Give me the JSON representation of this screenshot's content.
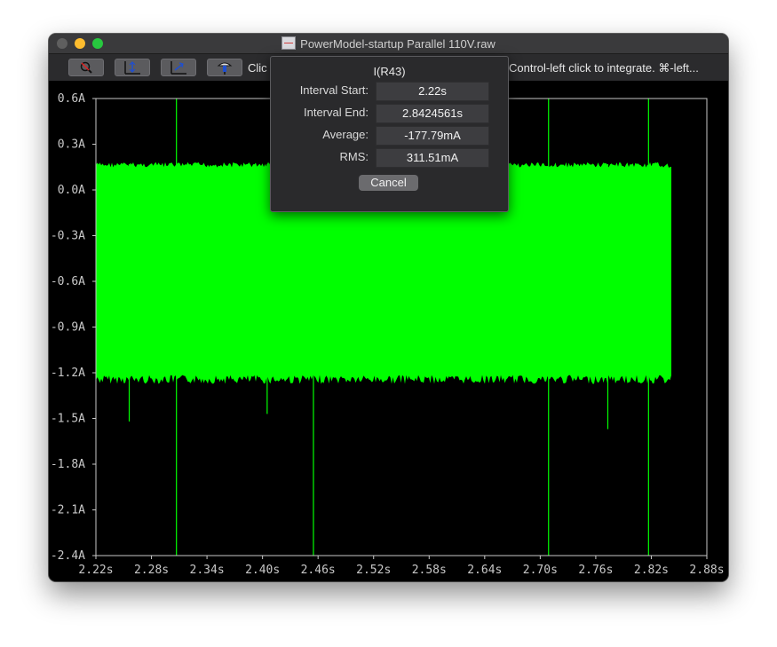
{
  "window": {
    "title": "PowerModel-startup Parallel 110V.raw",
    "title_icon": "waveform-document-icon"
  },
  "toolbar": {
    "buttons": [
      {
        "name": "zoom-out-button",
        "icon": "magnifier-cancel-icon"
      },
      {
        "name": "autorange-button",
        "icon": "fit-axis-icon"
      },
      {
        "name": "pan-button",
        "icon": "pan-arrows-icon"
      },
      {
        "name": "probe-button",
        "icon": "probe-icon"
      }
    ],
    "status_left": "Clic",
    "status_right": "Control-left click to integrate. ⌘-left..."
  },
  "integrate_dialog": {
    "title": "I(R43)",
    "fields": [
      {
        "label": "Interval Start:",
        "value": "2.22s"
      },
      {
        "label": "Interval End:",
        "value": "2.8424561s"
      },
      {
        "label": "Average:",
        "value": "-177.79mA"
      },
      {
        "label": "RMS:",
        "value": "311.51mA"
      }
    ],
    "cancel_label": "Cancel"
  },
  "chart_data": {
    "type": "area",
    "title": "",
    "xlabel": "",
    "ylabel": "",
    "xlim": [
      2.22,
      2.88
    ],
    "ylim": [
      -2.4,
      0.6
    ],
    "x_ticks": [
      "2.22s",
      "2.28s",
      "2.34s",
      "2.40s",
      "2.46s",
      "2.52s",
      "2.58s",
      "2.64s",
      "2.70s",
      "2.76s",
      "2.82s",
      "2.88s"
    ],
    "y_ticks": [
      "0.6A",
      "0.3A",
      "0.0A",
      "-0.3A",
      "-0.6A",
      "-0.9A",
      "-1.2A",
      "-1.5A",
      "-1.8A",
      "-2.1A",
      "-2.4A"
    ],
    "grid": false,
    "colors": {
      "trace": "#00ff00",
      "background": "#000000",
      "axis": "#c8c8c8"
    },
    "series": [
      {
        "name": "I(R43)",
        "x_range": [
          2.22,
          2.843
        ],
        "envelope_upper": 0.17,
        "envelope_lower": -1.25,
        "spikes": [
          {
            "x": 2.307,
            "y_max": 0.6,
            "y_min": -2.4
          },
          {
            "x": 2.256,
            "y_max": 0.17,
            "y_min": -1.52
          },
          {
            "x": 2.405,
            "y_max": 0.17,
            "y_min": -1.47
          },
          {
            "x": 2.455,
            "y_max": 0.17,
            "y_min": -2.4
          },
          {
            "x": 2.709,
            "y_max": 0.6,
            "y_min": -2.4
          },
          {
            "x": 2.773,
            "y_max": 0.17,
            "y_min": -1.57
          },
          {
            "x": 2.817,
            "y_max": 0.6,
            "y_min": -2.4
          }
        ]
      }
    ]
  }
}
